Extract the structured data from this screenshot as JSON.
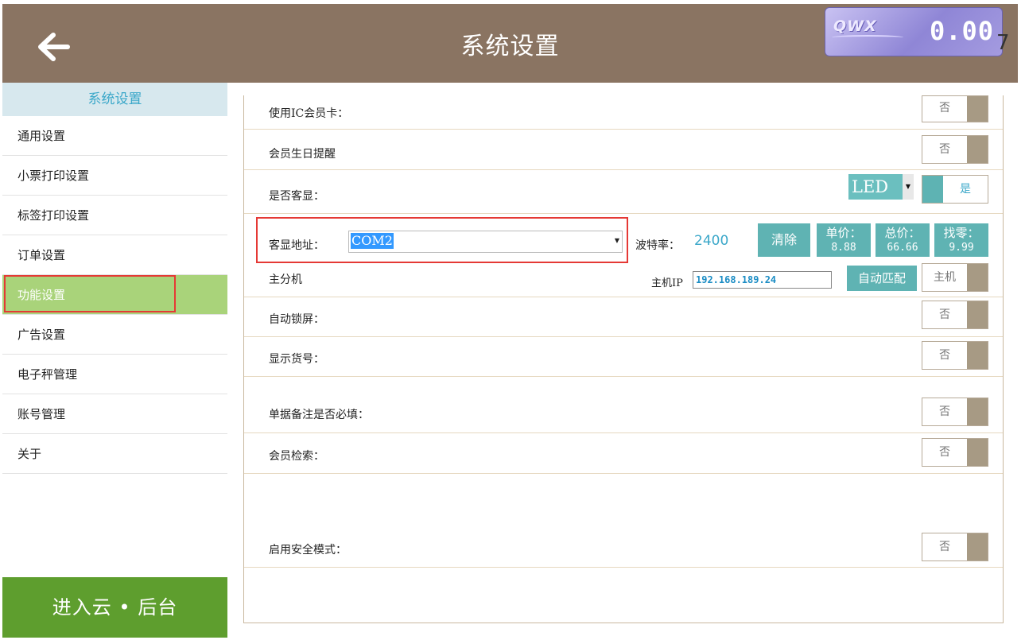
{
  "header": {
    "title": "系统设置",
    "display_logo": "QWX",
    "display_value": "0.00",
    "edge_digit": "7"
  },
  "sidebar": {
    "heading": "系统设置",
    "items": [
      {
        "label": "通用设置"
      },
      {
        "label": "小票打印设置"
      },
      {
        "label": "标签打印设置"
      },
      {
        "label": "订单设置"
      },
      {
        "label": "功能设置",
        "active": true
      },
      {
        "label": "广告设置"
      },
      {
        "label": "电子秤管理"
      },
      {
        "label": "账号管理"
      },
      {
        "label": "关于"
      }
    ],
    "cloud_button": "进入云 • 后台"
  },
  "settings": {
    "ic_card": {
      "label": "使用IC会员卡：",
      "value": "否"
    },
    "birthday": {
      "label": "会员生日提醒",
      "value": "否"
    },
    "customer_display": {
      "label": "是否客显：",
      "type": "LED",
      "value": "是"
    },
    "display_address": {
      "label": "客显地址：",
      "port": "COM2",
      "baud_label": "波特率：",
      "baud": "2400",
      "clear": "清除",
      "unit_price_label": "单价：",
      "unit_price": "8.88",
      "total_label": "总价：",
      "total": "66.66",
      "change_label": "找零：",
      "change": "9.99"
    },
    "host": {
      "label": "主分机",
      "ip_label": "主机IP",
      "ip": "192.168.189.24",
      "auto_match": "自动匹配",
      "role": "主机"
    },
    "auto_lock": {
      "label": "自动锁屏：",
      "value": "否"
    },
    "show_sku": {
      "label": "显示货号：",
      "value": "否"
    },
    "note_required": {
      "label": "单据备注是否必填：",
      "value": "否"
    },
    "member_search": {
      "label": "会员检索：",
      "value": "否"
    },
    "safe_mode": {
      "label": "启用安全模式：",
      "value": "否"
    }
  },
  "colors": {
    "header": "#8a7462",
    "active_item": "#a9d37a",
    "accent": "#5fb3b3",
    "cloud": "#5e9e2e",
    "highlight": "#e53935"
  }
}
